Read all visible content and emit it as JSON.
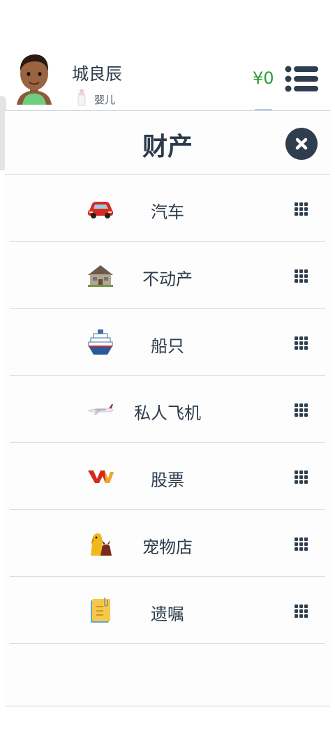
{
  "header": {
    "name": "城良辰",
    "status": "婴儿",
    "money": "¥0"
  },
  "panel": {
    "title": "财产",
    "items": [
      {
        "label": "汽车",
        "icon": "car-icon"
      },
      {
        "label": "不动产",
        "icon": "house-icon"
      },
      {
        "label": "船只",
        "icon": "ship-icon"
      },
      {
        "label": "私人飞机",
        "icon": "airplane-icon"
      },
      {
        "label": "股票",
        "icon": "stock-logo-icon"
      },
      {
        "label": "宠物店",
        "icon": "pets-icon"
      },
      {
        "label": "遗嘱",
        "icon": "will-document-icon"
      }
    ]
  },
  "colors": {
    "money": "#2e9a3a",
    "dark": "#2f3e4e",
    "divider": "#cfd3d8"
  }
}
